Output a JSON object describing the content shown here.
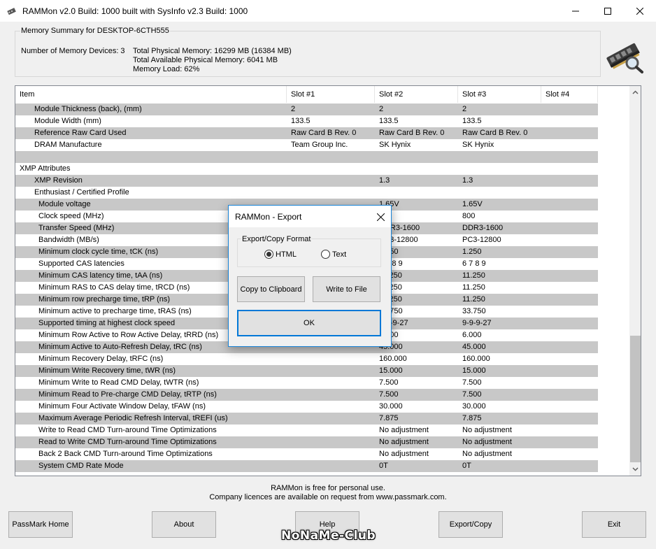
{
  "window": {
    "title": "RAMMon v2.0 Build: 1000 built with SysInfo v2.3 Build: 1000",
    "minimize_icon": "minimize-icon",
    "maximize_icon": "maximize-icon",
    "close_icon": "close-icon"
  },
  "summary": {
    "title": "Memory Summary for DESKTOP-6CTH555",
    "devices": "Number of Memory Devices: 3",
    "total_physical": "Total Physical Memory: 16299 MB (16384 MB)",
    "total_available": "Total Available Physical Memory: 6041 MB",
    "memory_load": "Memory Load: 62%"
  },
  "grid": {
    "columns": [
      "Item",
      "Slot #1",
      "Slot #2",
      "Slot #3",
      "Slot #4"
    ],
    "rows": [
      {
        "item": "Module Thickness (back), (mm)",
        "s1": "2",
        "s2": "2",
        "s3": "2",
        "s4": "",
        "indent": 1,
        "shade": true
      },
      {
        "item": "Module Width (mm)",
        "s1": "133.5",
        "s2": "133.5",
        "s3": "133.5",
        "s4": "",
        "indent": 1,
        "shade": false
      },
      {
        "item": "Reference Raw Card Used",
        "s1": "Raw Card B Rev. 0",
        "s2": "Raw Card B Rev. 0",
        "s3": "Raw Card B Rev. 0",
        "s4": "",
        "indent": 1,
        "shade": true
      },
      {
        "item": "DRAM Manufacture",
        "s1": "Team Group Inc.",
        "s2": "SK Hynix",
        "s3": "SK Hynix",
        "s4": "",
        "indent": 1,
        "shade": false
      },
      {
        "item": "",
        "s1": "",
        "s2": "",
        "s3": "",
        "s4": "",
        "indent": 0,
        "shade": true
      },
      {
        "item": "XMP Attributes",
        "s1": "",
        "s2": "",
        "s3": "",
        "s4": "",
        "indent": 0,
        "shade": false
      },
      {
        "item": "XMP Revision",
        "s1": "",
        "s2": "1.3",
        "s3": "1.3",
        "s4": "",
        "indent": 1,
        "shade": true
      },
      {
        "item": "Enthusiast / Certified Profile",
        "s1": "",
        "s2": "",
        "s3": "",
        "s4": "",
        "indent": 1,
        "shade": false
      },
      {
        "item": "Module voltage",
        "s1": "",
        "s2": "1.65V",
        "s3": "1.65V",
        "s4": "",
        "indent": 2,
        "shade": true
      },
      {
        "item": "Clock speed (MHz)",
        "s1": "",
        "s2": "800",
        "s3": "800",
        "s4": "",
        "indent": 2,
        "shade": false
      },
      {
        "item": "Transfer Speed (MHz)",
        "s1": "",
        "s2": "DDR3-1600",
        "s3": "DDR3-1600",
        "s4": "",
        "indent": 2,
        "shade": true
      },
      {
        "item": "Bandwidth (MB/s)",
        "s1": "",
        "s2": "PC3-12800",
        "s3": "PC3-12800",
        "s4": "",
        "indent": 2,
        "shade": false
      },
      {
        "item": "Minimum clock cycle time, tCK (ns)",
        "s1": "",
        "s2": "1.250",
        "s3": "1.250",
        "s4": "",
        "indent": 2,
        "shade": true
      },
      {
        "item": "Supported CAS latencies",
        "s1": "",
        "s2": "6 7 8 9",
        "s3": "6 7 8 9",
        "s4": "",
        "indent": 2,
        "shade": false
      },
      {
        "item": "Minimum CAS latency time, tAA (ns)",
        "s1": "",
        "s2": "11.250",
        "s3": "11.250",
        "s4": "",
        "indent": 2,
        "shade": true
      },
      {
        "item": "Minimum RAS to CAS delay time, tRCD (ns)",
        "s1": "",
        "s2": "11.250",
        "s3": "11.250",
        "s4": "",
        "indent": 2,
        "shade": false
      },
      {
        "item": "Minimum row precharge time, tRP (ns)",
        "s1": "",
        "s2": "11.250",
        "s3": "11.250",
        "s4": "",
        "indent": 2,
        "shade": true
      },
      {
        "item": "Minimum active to precharge time, tRAS (ns)",
        "s1": "",
        "s2": "33.750",
        "s3": "33.750",
        "s4": "",
        "indent": 2,
        "shade": false
      },
      {
        "item": "Supported timing at highest clock speed",
        "s1": "",
        "s2": "9-9-9-27",
        "s3": "9-9-9-27",
        "s4": "",
        "indent": 2,
        "shade": true
      },
      {
        "item": "Minimum Row Active to Row Active Delay, tRRD (ns)",
        "s1": "",
        "s2": "6.000",
        "s3": "6.000",
        "s4": "",
        "indent": 2,
        "shade": false
      },
      {
        "item": "Minimum Active to Auto-Refresh Delay, tRC (ns)",
        "s1": "",
        "s2": "45.000",
        "s3": "45.000",
        "s4": "",
        "indent": 2,
        "shade": true
      },
      {
        "item": "Minimum Recovery Delay, tRFC (ns)",
        "s1": "",
        "s2": "160.000",
        "s3": "160.000",
        "s4": "",
        "indent": 2,
        "shade": false
      },
      {
        "item": "Minimum Write Recovery time, tWR (ns)",
        "s1": "",
        "s2": "15.000",
        "s3": "15.000",
        "s4": "",
        "indent": 2,
        "shade": true
      },
      {
        "item": "Minimum Write to Read CMD Delay, tWTR (ns)",
        "s1": "",
        "s2": "7.500",
        "s3": "7.500",
        "s4": "",
        "indent": 2,
        "shade": false
      },
      {
        "item": "Minimum Read to Pre-charge CMD Delay, tRTP (ns)",
        "s1": "",
        "s2": "7.500",
        "s3": "7.500",
        "s4": "",
        "indent": 2,
        "shade": true
      },
      {
        "item": "Minimum Four Activate Window Delay, tFAW (ns)",
        "s1": "",
        "s2": "30.000",
        "s3": "30.000",
        "s4": "",
        "indent": 2,
        "shade": false
      },
      {
        "item": "Maximum Average Periodic Refresh Interval, tREFI (us)",
        "s1": "",
        "s2": "7.875",
        "s3": "7.875",
        "s4": "",
        "indent": 2,
        "shade": true
      },
      {
        "item": "Write to Read CMD Turn-around Time Optimizations",
        "s1": "",
        "s2": "No adjustment",
        "s3": "No adjustment",
        "s4": "",
        "indent": 2,
        "shade": false
      },
      {
        "item": "Read to Write CMD Turn-around Time Optimizations",
        "s1": "",
        "s2": "No adjustment",
        "s3": "No adjustment",
        "s4": "",
        "indent": 2,
        "shade": true
      },
      {
        "item": "Back 2 Back CMD Turn-around Time Optimizations",
        "s1": "",
        "s2": "No adjustment",
        "s3": "No adjustment",
        "s4": "",
        "indent": 2,
        "shade": false
      },
      {
        "item": "System CMD Rate Mode",
        "s1": "",
        "s2": "0T",
        "s3": "0T",
        "s4": "",
        "indent": 2,
        "shade": true
      }
    ]
  },
  "footer": {
    "line1": "RAMMon is free for personal use.",
    "line2": "Company licences are available on request from www.passmark.com."
  },
  "buttons": {
    "passmark_home": "PassMark Home",
    "about": "About",
    "help": "Help",
    "export_copy": "Export/Copy",
    "exit": "Exit"
  },
  "watermark": "NoNaMe-Club",
  "dialog": {
    "title": "RAMMon - Export",
    "group_label": "Export/Copy Format",
    "radio_html": "HTML",
    "radio_text": "Text",
    "selected": "HTML",
    "copy_to_clipboard": "Copy to Clipboard",
    "write_to_file": "Write to File",
    "ok": "OK"
  },
  "colors": {
    "row_shade": "#c8c8c8",
    "dialog_border": "#1883d7",
    "ok_focus": "#0078d7"
  }
}
